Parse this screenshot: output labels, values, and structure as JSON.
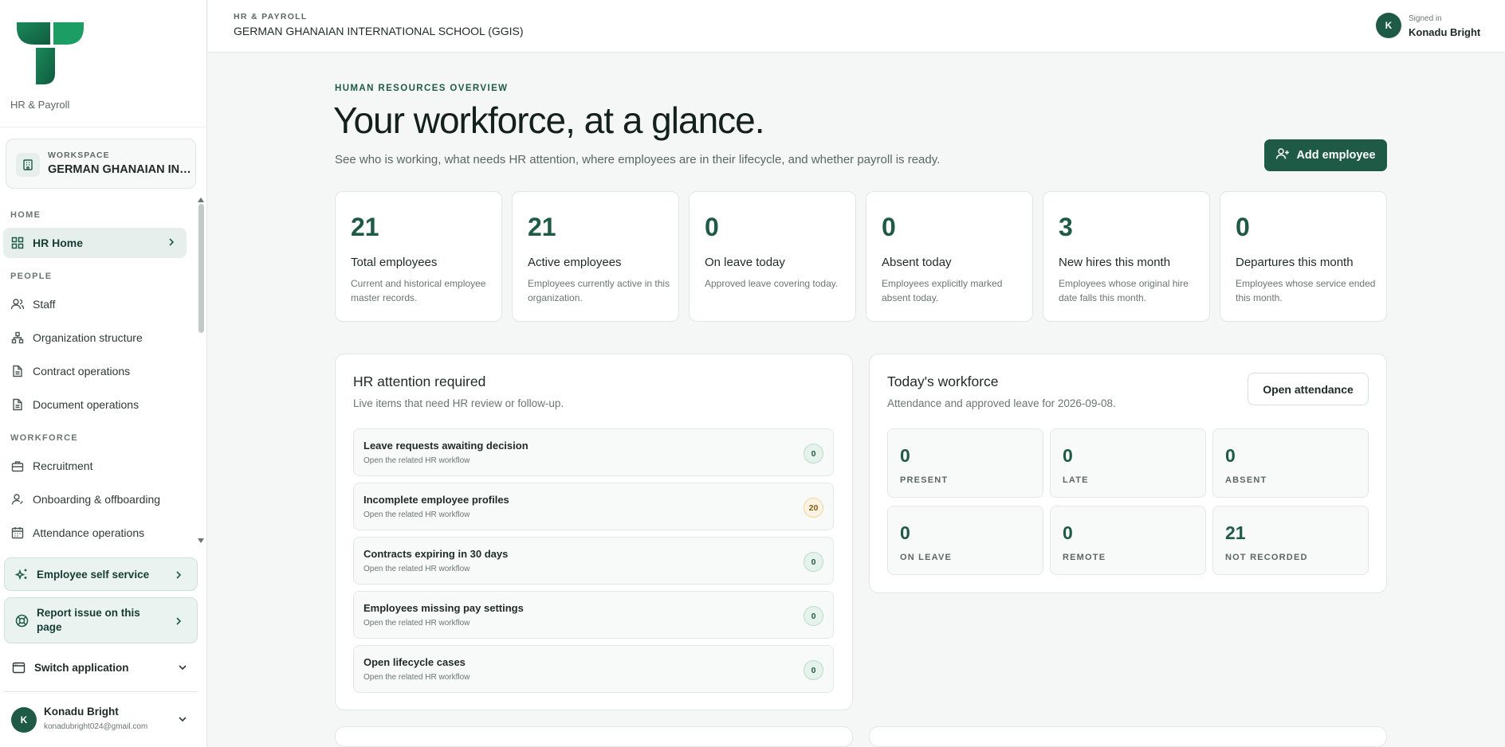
{
  "brand": {
    "app_name": "HR & Payroll",
    "accent": "#1f5a47"
  },
  "workspace": {
    "label": "WORKSPACE",
    "name": "GERMAN GHANAIAN INTERNATIONAL SCHOOL (GGIS)",
    "icon": "building-icon"
  },
  "nav": {
    "sections": [
      {
        "label": "HOME"
      },
      {
        "label": "PEOPLE"
      },
      {
        "label": "WORKFORCE"
      }
    ],
    "items": [
      {
        "label": "HR Home",
        "icon": "grid-icon",
        "active": true
      },
      {
        "label": "Staff",
        "icon": "users-icon"
      },
      {
        "label": "Organization structure",
        "icon": "org-chart-icon"
      },
      {
        "label": "Contract operations",
        "icon": "document-icon"
      },
      {
        "label": "Document operations",
        "icon": "document-icon"
      },
      {
        "label": "Recruitment",
        "icon": "briefcase-icon"
      },
      {
        "label": "Onboarding & offboarding",
        "icon": "user-icon"
      },
      {
        "label": "Attendance operations",
        "icon": "calendar-icon"
      }
    ]
  },
  "sidebar_actions": {
    "self_service": "Employee self service",
    "report_issue": "Report issue on this page",
    "switch_app": "Switch application"
  },
  "user": {
    "initial": "K",
    "name": "Konadu Bright",
    "email": "konadubright024@gmail.com",
    "signed_in_label": "Signed in"
  },
  "header": {
    "kicker": "HR & PAYROLL",
    "org": "GERMAN GHANAIAN INTERNATIONAL SCHOOL (GGIS)"
  },
  "hero": {
    "kicker": "HUMAN RESOURCES OVERVIEW",
    "title": "Your workforce, at a glance.",
    "description": "See who is working, what needs HR attention, where employees are in their lifecycle, and whether payroll is ready.",
    "add_button": "Add employee"
  },
  "stats": [
    {
      "value": "21",
      "label": "Total employees",
      "desc": "Current and historical employee master records."
    },
    {
      "value": "21",
      "label": "Active employees",
      "desc": "Employees currently active in this organization."
    },
    {
      "value": "0",
      "label": "On leave today",
      "desc": "Approved leave covering today."
    },
    {
      "value": "0",
      "label": "Absent today",
      "desc": "Employees explicitly marked absent today."
    },
    {
      "value": "3",
      "label": "New hires this month",
      "desc": "Employees whose original hire date falls this month."
    },
    {
      "value": "0",
      "label": "Departures this month",
      "desc": "Employees whose service ended this month."
    }
  ],
  "attention": {
    "title": "HR attention required",
    "subtitle": "Live items that need HR review or follow-up.",
    "items": [
      {
        "title": "Leave requests awaiting decision",
        "sub": "Open the related HR workflow",
        "count": "0",
        "status": "ok"
      },
      {
        "title": "Incomplete employee profiles",
        "sub": "Open the related HR workflow",
        "count": "20",
        "status": "warn"
      },
      {
        "title": "Contracts expiring in 30 days",
        "sub": "Open the related HR workflow",
        "count": "0",
        "status": "ok"
      },
      {
        "title": "Employees missing pay settings",
        "sub": "Open the related HR workflow",
        "count": "0",
        "status": "ok"
      },
      {
        "title": "Open lifecycle cases",
        "sub": "Open the related HR workflow",
        "count": "0",
        "status": "ok"
      }
    ]
  },
  "workforce": {
    "title": "Today's workforce",
    "subtitle": "Attendance and approved leave for 2026-09-08.",
    "open_button": "Open attendance",
    "tiles": [
      {
        "value": "0",
        "label": "PRESENT"
      },
      {
        "value": "0",
        "label": "LATE"
      },
      {
        "value": "0",
        "label": "ABSENT"
      },
      {
        "value": "0",
        "label": "ON LEAVE"
      },
      {
        "value": "0",
        "label": "REMOTE"
      },
      {
        "value": "21",
        "label": "NOT RECORDED"
      }
    ]
  }
}
